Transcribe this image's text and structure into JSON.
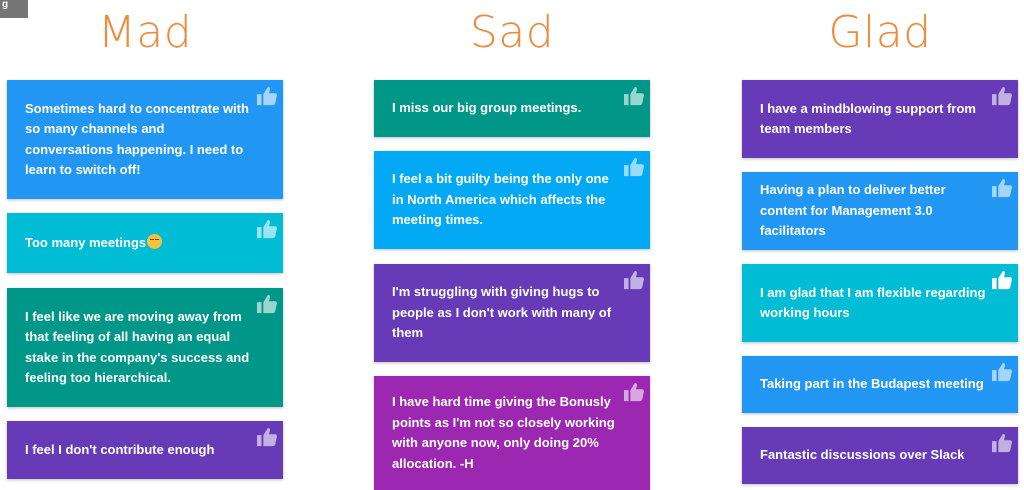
{
  "corner_label": "g",
  "colors": {
    "title": "#EE8A3C",
    "blue": "#2196F3",
    "cyan": "#00BCD4",
    "teal": "#009688",
    "light_blue": "#03A9F4",
    "deep_purple": "#673AB7",
    "purple": "#9C27B0"
  },
  "like_icon": "thumbs-up-icon",
  "columns": [
    {
      "title": "Mad",
      "cards": [
        {
          "text": "Sometimes hard to concentrate with so many channels and conversations happening. I need to learn to switch off!",
          "color": "#2196F3"
        },
        {
          "text": "Too many meetings",
          "emoji": "relieved-face-emoji",
          "color": "#00BCD4"
        },
        {
          "text": "I feel like we are moving away from that feeling of all having an equal stake in the company's success and feeling too hierarchical.",
          "color": "#009688"
        },
        {
          "text": "I feel I don't contribute enough",
          "color": "#673AB7"
        }
      ]
    },
    {
      "title": "Sad",
      "cards": [
        {
          "text": "I miss our big group meetings.",
          "color": "#009688"
        },
        {
          "text": "I feel a bit guilty being the only one in North America which affects the meeting times.",
          "color": "#03A9F4"
        },
        {
          "text": "I'm struggling with giving hugs to people as I don't work with many of them",
          "color": "#673AB7"
        },
        {
          "text": "I have hard time giving the Bonusly points as I'm not so closely working with anyone now, only doing 20% allocation. -H",
          "color": "#9C27B0"
        }
      ]
    },
    {
      "title": "Glad",
      "cards": [
        {
          "text": "I have a mindblowing support from team members",
          "color": "#673AB7"
        },
        {
          "text": "Having a plan to deliver better content for Management 3.0 facilitators",
          "color": "#2196F3"
        },
        {
          "text": "I am glad that I am flexible regarding working hours",
          "color": "#00BCD4",
          "liked": true
        },
        {
          "text": "Taking part in the Budapest meeting",
          "color": "#2196F3"
        },
        {
          "text": "Fantastic discussions over Slack",
          "color": "#673AB7"
        }
      ]
    }
  ]
}
